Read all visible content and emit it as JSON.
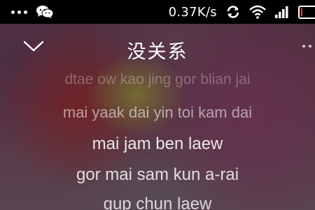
{
  "status_bar": {
    "network_speed": "0.37K/s",
    "icons": [
      "more-dots-icon",
      "wechat-icon",
      "sync-icon",
      "wifi-icon",
      "signal-icon",
      "battery-icon"
    ],
    "battery_color": "#e53935"
  },
  "player": {
    "song_title": "没关系",
    "icons": [
      "chevron-down-icon",
      "more-icon"
    ]
  },
  "lyrics": [
    "dtae ow kao jing gor blian jai",
    "mai yaak dai yin toi kam dai",
    "mai jam ben laew",
    "gor mai sam kun a-rai",
    "gup chun laew"
  ]
}
